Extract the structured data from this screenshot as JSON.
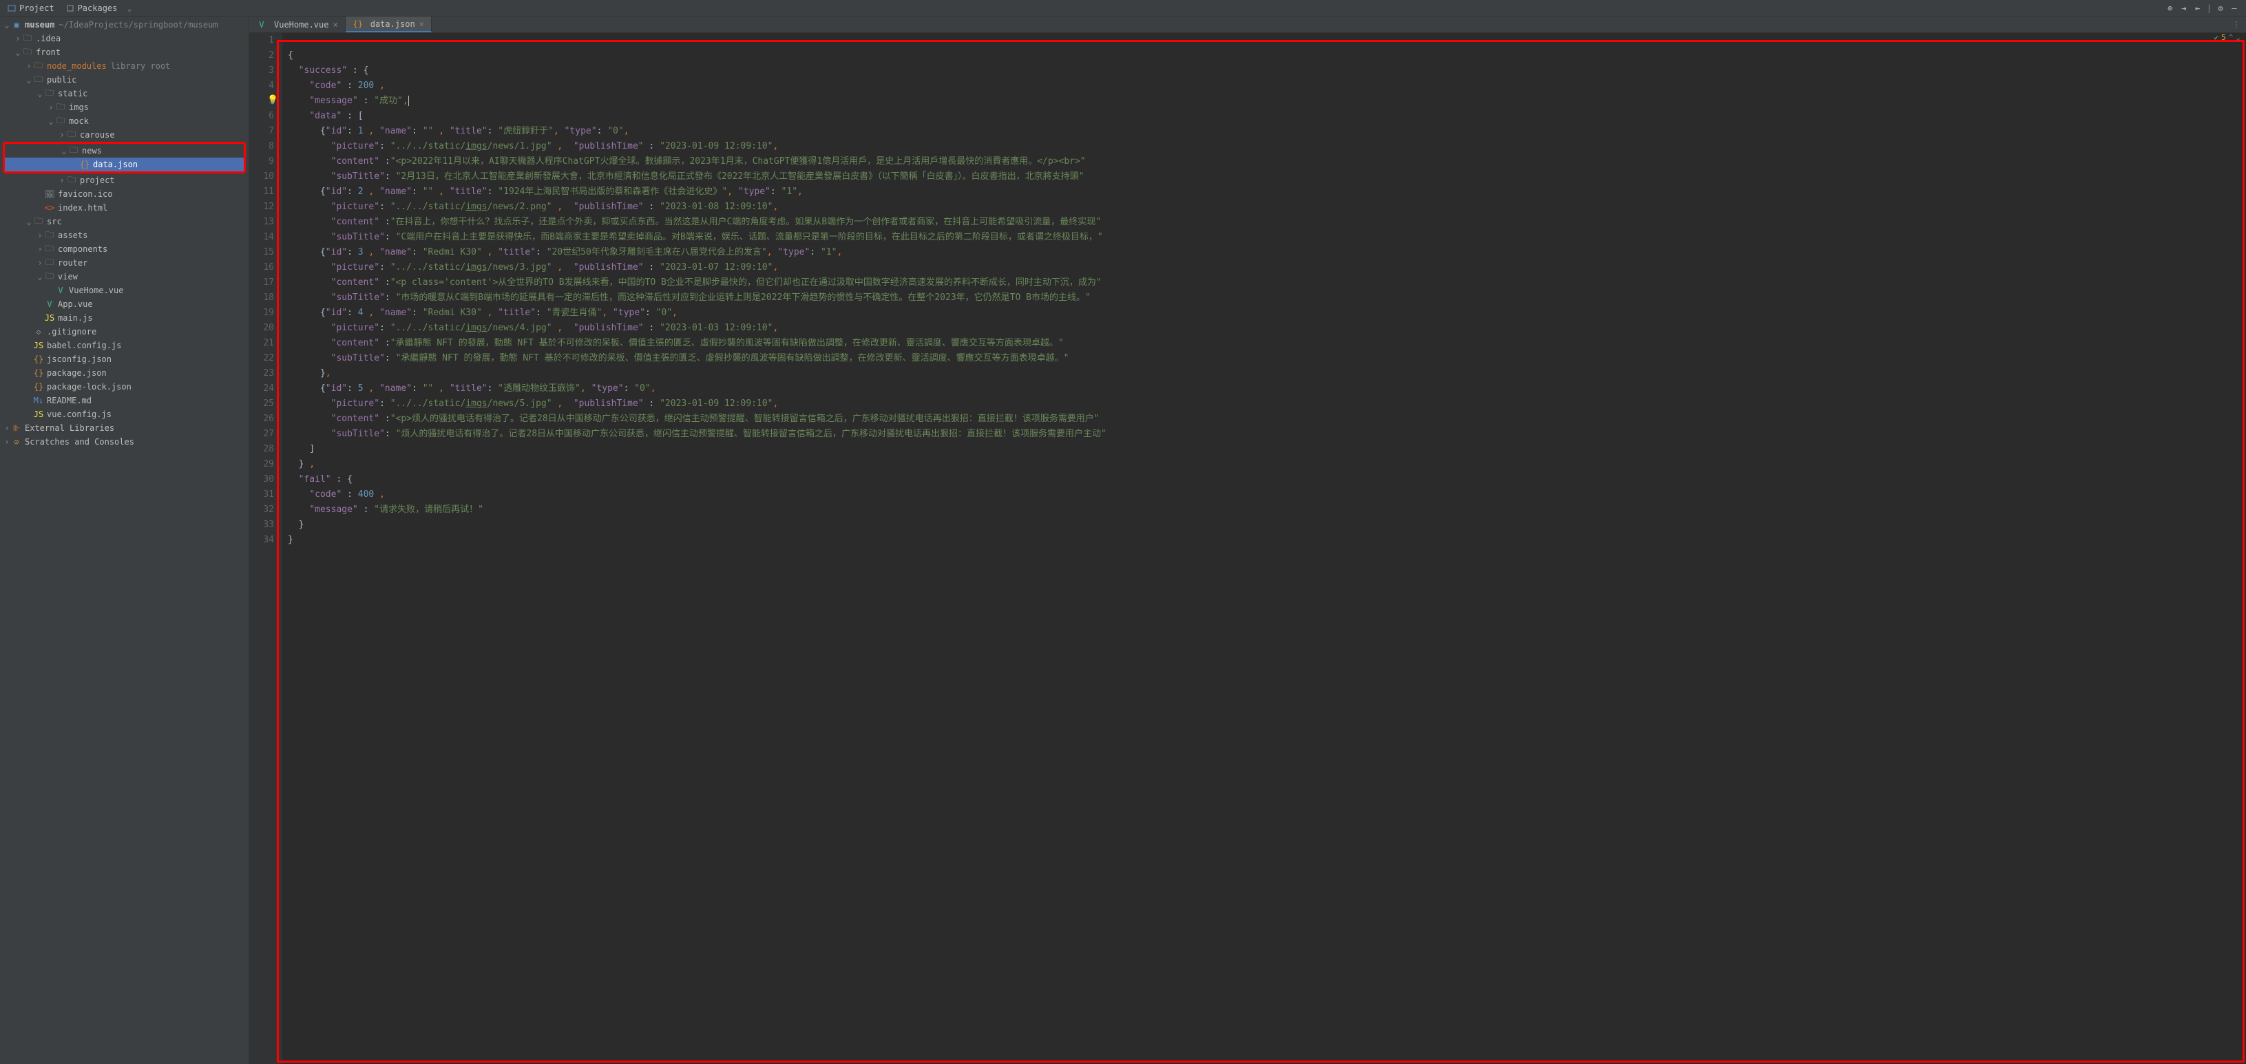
{
  "toolbar": {
    "project_label": "Project",
    "packages_label": "Packages"
  },
  "tree": {
    "root": {
      "name": "museum",
      "path": "~/IdeaProjects/springboot/museum"
    },
    "idea": ".idea",
    "front": "front",
    "node_modules": "node_modules",
    "node_modules_hint": "library root",
    "public": "public",
    "static": "static",
    "imgs": "imgs",
    "mock": "mock",
    "carouse": "carouse",
    "news": "news",
    "data_json": "data.json",
    "project": "project",
    "favicon": "favicon.ico",
    "index_html": "index.html",
    "src": "src",
    "assets": "assets",
    "components": "components",
    "router": "router",
    "view": "view",
    "vuehome": "VueHome.vue",
    "app_vue": "App.vue",
    "main_js": "main.js",
    "gitignore": ".gitignore",
    "babel": "babel.config.js",
    "jsconfig": "jsconfig.json",
    "package_json": "package.json",
    "package_lock": "package-lock.json",
    "readme": "README.md",
    "vue_config": "vue.config.js",
    "ext_lib": "External Libraries",
    "scratches": "Scratches and Consoles"
  },
  "tabs": {
    "vuehome": "VueHome.vue",
    "data_json": "data.json"
  },
  "status": {
    "problems": "5"
  },
  "code": {
    "success": "success",
    "code_key": "code",
    "code_val": "200",
    "message_key": "message",
    "message_val": "成功",
    "data_key": "data",
    "items": [
      {
        "id": "1",
        "name": "",
        "title": "虎纽錞釪于",
        "type": "0",
        "picture": "../../static/imgs/news/1.jpg",
        "publishTime": "2023-01-09 12:09:10",
        "content": "<p>2022年11月以来，AI聊天機器人程序ChatGPT火爆全球。數據顯示，2023年1月末，ChatGPT便獲得1億月活用戶，是史上月活用戶增長最快的消費者應用。</p><br>",
        "subTitle": "2月13日，在北京人工智能産業創新發展大會，北京市經濟和信息化局正式發布《2022年北京人工智能産業發展白皮書》（以下簡稱「白皮書」）。白皮書指出，北京將支持頭"
      },
      {
        "id": "2",
        "name": "",
        "title": "1924年上海民智书局出版的蔡和森著作《社会进化史》",
        "type": "1",
        "picture": "../../static/imgs/news/2.png",
        "publishTime": "2023-01-08 12:09:10",
        "content": "在抖音上，你想干什么？找点乐子，还是点个外卖，抑或买点东西。当然这是从用户C端的角度考虑。如果从B端作为一个创作者或者商家，在抖音上可能希望吸引流量，最终实现",
        "subTitle": "C端用户在抖音上主要是获得快乐，而B端商家主要是希望卖掉商品。对B端来说，娱乐、话题、流量都只是第一阶段的目标，在此目标之后的第二阶段目标，或者谓之终极目标，"
      },
      {
        "id": "3",
        "name": "Redmi K30",
        "title": "20世纪50年代象牙雕刻毛主席在八届党代会上的发言",
        "type": "1",
        "picture": "../../static/imgs/news/3.jpg",
        "publishTime": "2023-01-07 12:09:10",
        "content": "<p class='content'>从全世界的TO B发展线来看，中国的TO B企业不是脚步最快的，但它们却也正在通过汲取中国数字经济高速发展的养料不断成长，同时主动下沉，成为",
        "subTitle": "市场的暖意从C端到B端市场的延展具有一定的滞后性，而这种滞后性对应到企业运转上则是2022年下滑趋势的惯性与不确定性。在整个2023年，它仍然是TO B市场的主线。"
      },
      {
        "id": "4",
        "name": "Redmi K30",
        "title": "青瓷生肖俑",
        "type": "0",
        "picture": "../../static/imgs/news/4.jpg",
        "publishTime": "2023-01-03 12:09:10",
        "content": "承繼靜態 NFT 的發展，動態 NFT 基於不可修改的呆板、價值主張的匱乏、虛假抄襲的風波等固有缺陷做出調整，在修改更新、靈活調度、響應交互等方面表現卓越。",
        "subTitle": "承繼靜態 NFT 的發展，動態 NFT 基於不可修改的呆板、價值主張的匱乏、虛假抄襲的風波等固有缺陷做出調整，在修改更新、靈活調度、響應交互等方面表現卓越。"
      },
      {
        "id": "5",
        "name": "",
        "title": "透雕动物纹玉嵌饰",
        "type": "0",
        "picture": "../../static/imgs/news/5.jpg",
        "publishTime": "2023-01-09 12:09:10",
        "content": "<p>烦人的骚扰电话有得治了。记者28日从中国移动广东公司获悉，继闪信主动预警提醒、智能转接留言信箱之后，广东移动对骚扰电话再出狠招：直接拦截！该项服务需要用户",
        "subTitle": "烦人的骚扰电话有得治了。记者28日从中国移动广东公司获悉，继闪信主动预警提醒、智能转接留言信箱之后，广东移动对骚扰电话再出狠招：直接拦截！该项服务需要用户主动"
      }
    ],
    "fail_key": "fail",
    "fail_code": "400",
    "fail_message": "请求失败，请稍后再试！"
  }
}
